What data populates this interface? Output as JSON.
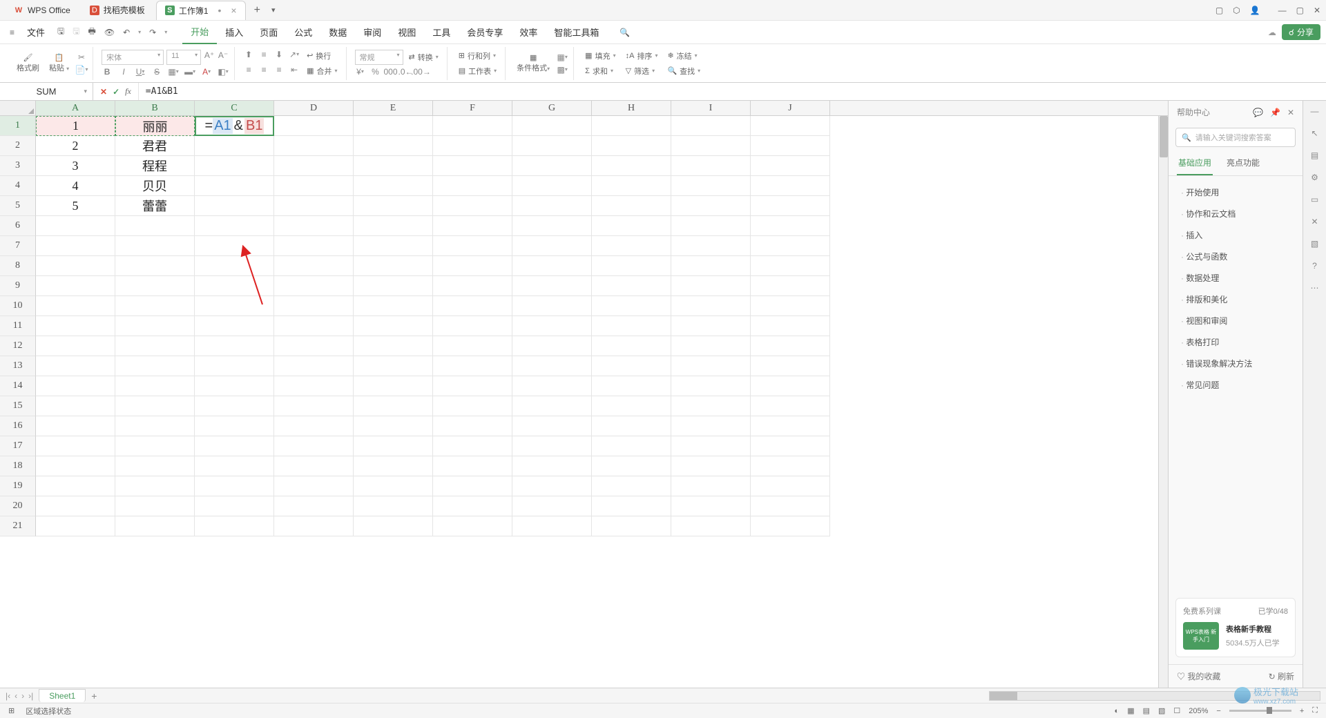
{
  "titlebar": {
    "tab1": "WPS Office",
    "tab2": "找稻壳模板",
    "tab3": "工作簿1",
    "s_icon": "S"
  },
  "menu": {
    "file": "文件",
    "items": [
      "开始",
      "插入",
      "页面",
      "公式",
      "数据",
      "审阅",
      "视图",
      "工具",
      "会员专享",
      "效率",
      "智能工具箱"
    ]
  },
  "share": "分享",
  "ribbon": {
    "fmt_brush": "格式刷",
    "paste": "粘贴",
    "font": "宋体",
    "size": "11",
    "bold": "B",
    "italic": "I",
    "underline": "U",
    "strike": "S",
    "wrap": "换行",
    "merge": "合并",
    "general": "常规",
    "transform": "转换",
    "cond_fmt": "条件格式",
    "rowcol": "行和列",
    "worksheet": "工作表",
    "fill": "填充",
    "sort": "排序",
    "freeze": "冻结",
    "sum": "求和",
    "filter": "筛选",
    "find": "查找"
  },
  "namebox": "SUM",
  "formula": "=A1&B1",
  "columns": [
    "A",
    "B",
    "C",
    "D",
    "E",
    "F",
    "G",
    "H",
    "I",
    "J"
  ],
  "row_nums": [
    "1",
    "2",
    "3",
    "4",
    "5",
    "6",
    "7",
    "8",
    "9",
    "10",
    "11",
    "12",
    "13",
    "14",
    "15",
    "16",
    "17",
    "18",
    "19",
    "20",
    "21"
  ],
  "cells": {
    "a": [
      "1",
      "2",
      "3",
      "4",
      "5"
    ],
    "b": [
      "丽丽",
      "君君",
      "程程",
      "贝贝",
      "蕾蕾"
    ]
  },
  "editing": {
    "eq": "=",
    "ref1": "A1",
    "amp": "&",
    "ref2": "B1"
  },
  "help": {
    "title": "帮助中心",
    "search_ph": "请输入关键词搜索答案",
    "tab1": "基础应用",
    "tab2": "亮点功能",
    "items": [
      "开始使用",
      "协作和云文档",
      "插入",
      "公式与函数",
      "数据处理",
      "排版和美化",
      "视图和审阅",
      "表格打印",
      "错误现象解决方法",
      "常见问题"
    ],
    "course_hdr": "免费系列课",
    "course_progress": "已学0/48",
    "course_thumb": "WPS表格\n新手入门",
    "course_title": "表格新手教程",
    "course_sub": "5034.5万人已学",
    "fav": "我的收藏",
    "refresh": "刷新"
  },
  "sheet_tab": "Sheet1",
  "status": {
    "mode": "区域选择状态",
    "zoom": "205%"
  },
  "watermark": {
    "name": "极光下载站",
    "url": "www.xz7.com"
  }
}
